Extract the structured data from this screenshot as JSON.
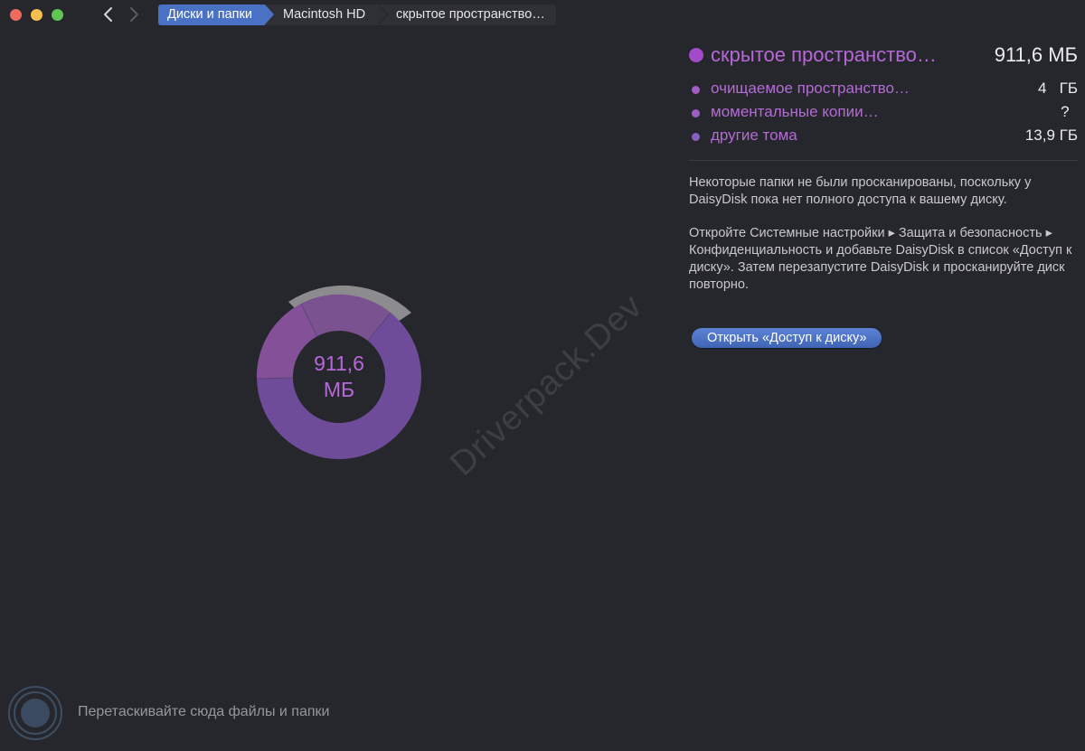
{
  "window": {
    "traffic_lights": {
      "close": "#ed6a5e",
      "minimize": "#f5bf4f",
      "zoom": "#61c554"
    },
    "nav": {
      "back_icon": "chevron-left-icon",
      "forward_icon": "chevron-right-icon"
    }
  },
  "breadcrumb": [
    {
      "label": "Диски и папки"
    },
    {
      "label": "Macintosh HD"
    },
    {
      "label": "скрытое пространство…"
    }
  ],
  "chart": {
    "center_value": "911,6",
    "center_unit": "МБ"
  },
  "watermark": "Driverpack.Dev",
  "panel": {
    "main": {
      "label": "скрытое пространство…",
      "value": "911,6 МБ",
      "color": "#a24ac8"
    },
    "items": [
      {
        "label": "очищаемое пространство…",
        "value": "4   ГБ",
        "color": "#a35dc6"
      },
      {
        "label": "моментальные копии…",
        "value": "?  ",
        "color": "#9a5ec7"
      },
      {
        "label": "другие тома",
        "value": "13,9 ГБ",
        "color": "#8a5ec2"
      }
    ],
    "note_1": "Некоторые папки не были просканированы, поскольку у DaisyDisk пока нет полного доступа к вашему диску.",
    "note_2": "Откройте Системные настройки ▸ Защита и безопасность ▸ Конфиденциальность и добавьте DaisyDisk в список «Доступ к диску». Затем перезапустите DaisyDisk и просканируйте диск повторно.",
    "open_button": "Открыть «Доступ к диску»"
  },
  "footer": {
    "drop_hint": "Перетаскивайте сюда файлы и папки"
  }
}
